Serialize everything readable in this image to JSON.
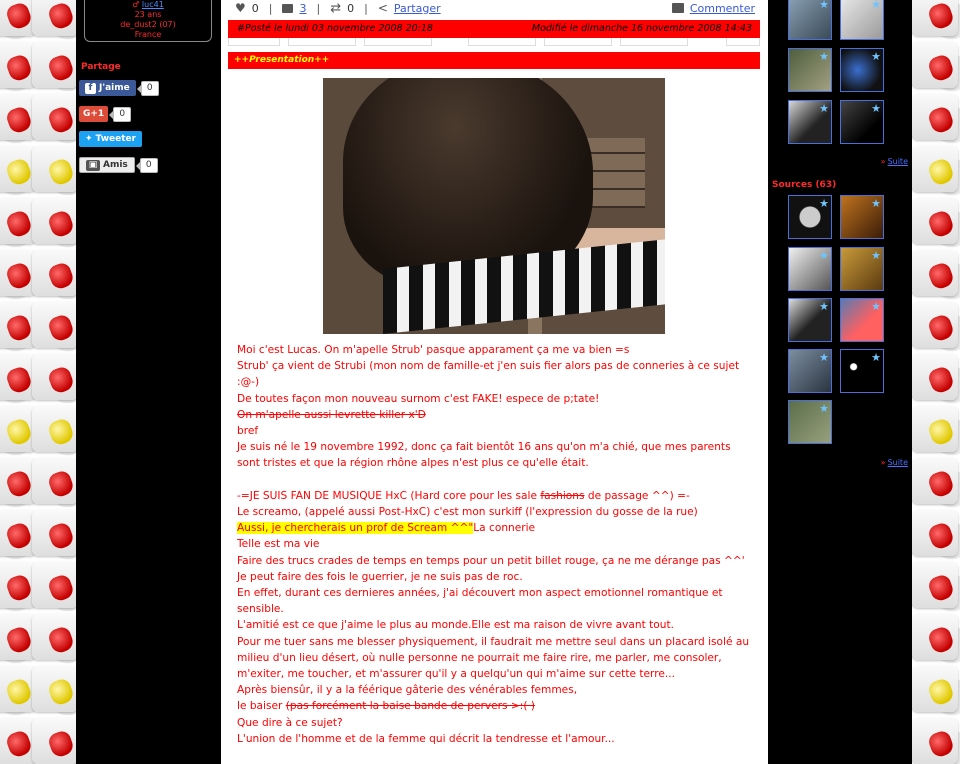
{
  "profile": {
    "username": "luc41",
    "age": "23 ans",
    "location_line": "de_dust2 (07)",
    "country": "France"
  },
  "share": {
    "title": "Partage",
    "facebook": {
      "label": "J'aime",
      "count": "0",
      "icon": "facebook-icon"
    },
    "google": {
      "label": "G+1",
      "count": "0",
      "icon": "google-plus-icon"
    },
    "twitter": {
      "label": "Tweeter",
      "icon": "twitter-bird-icon"
    },
    "friends": {
      "label": "Amis",
      "count": "0",
      "icon": "friends-card-icon"
    }
  },
  "actions": {
    "likes": "0",
    "comments_link": "3",
    "reposts": "0",
    "share_label": "Partager",
    "comment_label": "Commenter"
  },
  "post": {
    "posted": "#Posté le lundi 03 novembre 2008 20:18",
    "modified": "Modifié le dimanche 16 novembre 2008 14:43",
    "section_title": "++Presentation++"
  },
  "body": {
    "l1": "Moi c'est Lucas. On m'apelle Strub' pasque apparament ça me va bien =s",
    "l2": "Strub' ça vient de Strubi (mon nom de famille-et j'en suis fier alors pas de conneries à ce sujet :@-)",
    "l3": "De toutes façon mon nouveau surnom c'est FAKE! espece de p;tate!",
    "l4": "On m'apelle aussi levrette killer x'D",
    "l5": "bref",
    "l6": "Je suis né le 19 novembre 1992, donc ça fait bientôt 16 ans qu'on m'a chié, que mes parents sont tristes et que la région rhône alpes n'est plus ce qu'elle était.",
    "l7a": "-=JE SUIS FAN DE MUSIQUE HxC (Hard core pour les sale ",
    "l7b": "fashions",
    "l7c": " de passage ^^) =-",
    "l8": "Le screamo, (appelé aussi Post-HxC) c'est mon surkiff (l'expression du gosse de la rue)",
    "l9a": "Aussi, je chercherais un prof de Scream ^^\"",
    "l9b": "La connerie",
    "l10": "Telle est ma vie",
    "l11": "Faire des trucs crades de temps en temps pour un petit billet rouge, ça ne me dérange pas ^^'",
    "l12": "Je peut faire des fois le guerrier, je ne suis pas de roc.",
    "l13": "En effet, durant ces dernieres années, j'ai découvert mon aspect emotionnel romantique et sensible.",
    "l14": "L'amitié est ce que j'aime le plus au monde.Elle est ma raison de vivre avant tout.",
    "l15": "Pour me tuer sans me blesser physiquement, il faudrait me mettre seul dans un placard isolé au milieu d'un lieu désert, où nulle personne ne pourrait me faire rire, me parler, me consoler, m'exiter, me toucher, et m'assurer qu'il y a quelqu'un qui m'aime sur cette terre...",
    "l16": "Après biensûr, il y a la féérique gâterie des vénérables femmes,",
    "l17a": "le baiser ",
    "l17b": "(pas forcément la baise bande de pervers >:( )",
    "l18": "Que dire à ce sujet?",
    "l19": "L'union de l'homme et de la femme qui décrit la tendresse et l'amour..."
  },
  "right": {
    "suite_1": "Suite",
    "sources_title": "Sources (63)",
    "suite_2": "Suite"
  },
  "colors": {
    "accent_red": "#ff0000",
    "section_text": "#ffff00",
    "highlight": "#ffff00",
    "link_blue": "#3a5ad9"
  }
}
